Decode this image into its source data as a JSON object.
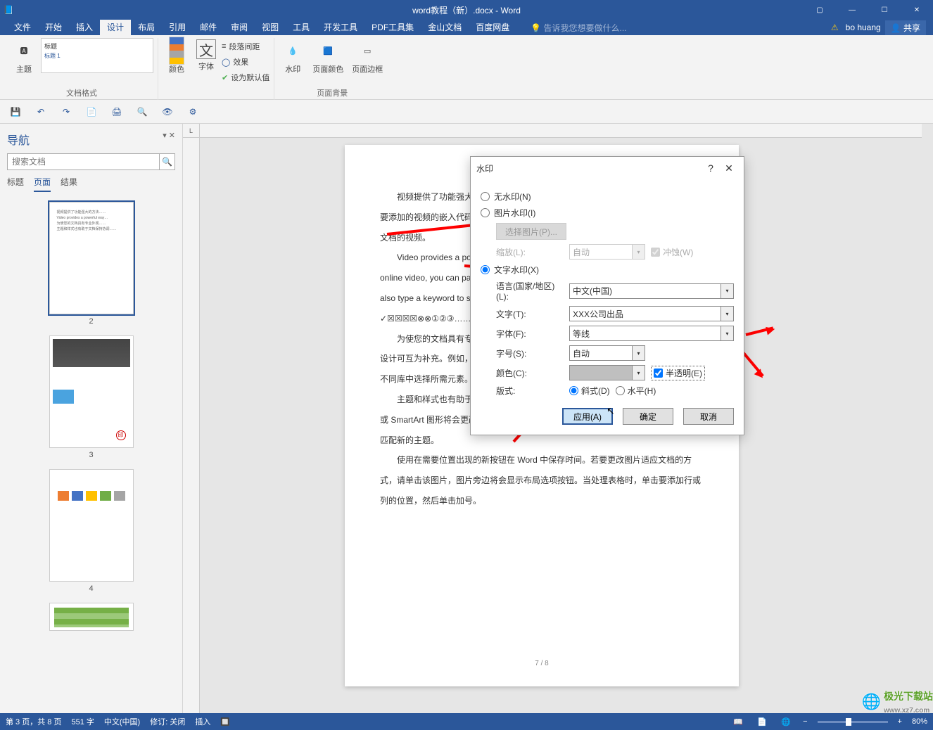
{
  "titlebar": {
    "doc_title": "word教程（新）.docx - Word"
  },
  "menu": {
    "tabs": [
      "文件",
      "开始",
      "插入",
      "设计",
      "布局",
      "引用",
      "邮件",
      "审阅",
      "视图",
      "工具",
      "开发工具",
      "PDF工具集",
      "金山文档",
      "百度网盘"
    ],
    "active_index": 3,
    "tellme": "告诉我您想要做什么...",
    "user": "bo huang",
    "share": "共享"
  },
  "ribbon": {
    "themes_label": "主题",
    "formats_label": "文档格式",
    "style_title": "标题",
    "style_heading": "标题 1",
    "colors": "颜色",
    "fonts": "字体",
    "para_spacing": "段落间距",
    "effects": "效果",
    "set_default": "设为默认值",
    "watermark": "水印",
    "page_color": "页面颜色",
    "page_border": "页面边框",
    "page_bg_label": "页面背景"
  },
  "qat": {
    "save": "保存",
    "undo": "撤销",
    "redo": "重做"
  },
  "nav": {
    "title": "导航",
    "search_placeholder": "搜索文档",
    "tabs": [
      "标题",
      "页面",
      "结果"
    ],
    "active_tab": 1,
    "thumbs": [
      "2",
      "3",
      "4"
    ]
  },
  "doc": {
    "paragraphs": [
      "视频提供了功能强大的方法帮助您证明您的观点。当您单击联机视频时，可以在想要添加的视频的嵌入代码中进行粘贴。您也可以键入一个关键字以联机搜索最适合您的文档的视频。",
      "Video provides a powerful way to help you prove your point. When you click the online video, you can paste in the embed code for the video you want to add. You can also type a keyword to search online for the video that best fits your document.",
      "✓☒☒☒☒⊗⊗①②③……",
      "为使您的文档具有专业外观，Word 提供了页眉、页脚、封面和文本框设计，这些设计可互为补充。例如，您可以添加匹配的封面、页眉和提要栏。单击\"插入\"，然后从不同库中选择所需元素。",
      "主题和样式也有助于文档保持协调。当您单击设计并选择新的主题时，图片、图表或 SmartArt 图形将会更改以匹配新的主题。当应用样式时，（您的标题）会进行更改以匹配新的主题。",
      "使用在需要位置出现的新按钮在 Word 中保存时间。若要更改图片适应文档的方式，请单击该图片，图片旁边将会显示布局选项按钮。当处理表格时，单击要添加行或列的位置，然后单击加号。"
    ],
    "page_num": "7 / 8"
  },
  "dialog": {
    "title": "水印",
    "no_watermark": "无水印(N)",
    "picture_watermark": "图片水印(I)",
    "select_picture": "选择图片(P)...",
    "scale": "缩放(L):",
    "scale_val": "自动",
    "washout": "冲蚀(W)",
    "text_watermark": "文字水印(X)",
    "language": "语言(国家/地区)(L):",
    "language_val": "中文(中国)",
    "text": "文字(T):",
    "text_val": "XXX公司出品",
    "font": "字体(F):",
    "font_val": "等线",
    "size": "字号(S):",
    "size_val": "自动",
    "color": "颜色(C):",
    "translucent": "半透明(E)",
    "layout": "版式:",
    "diagonal": "斜式(D)",
    "horizontal": "水平(H)",
    "apply": "应用(A)",
    "ok": "确定",
    "cancel": "取消"
  },
  "status": {
    "page": "第 3 页，共 8 页",
    "words": "551 字",
    "lang": "中文(中国)",
    "track": "修订: 关闭",
    "insert": "插入",
    "zoom": "80%"
  },
  "corner_logo": "极光下载站",
  "corner_url": "www.xz7.com"
}
